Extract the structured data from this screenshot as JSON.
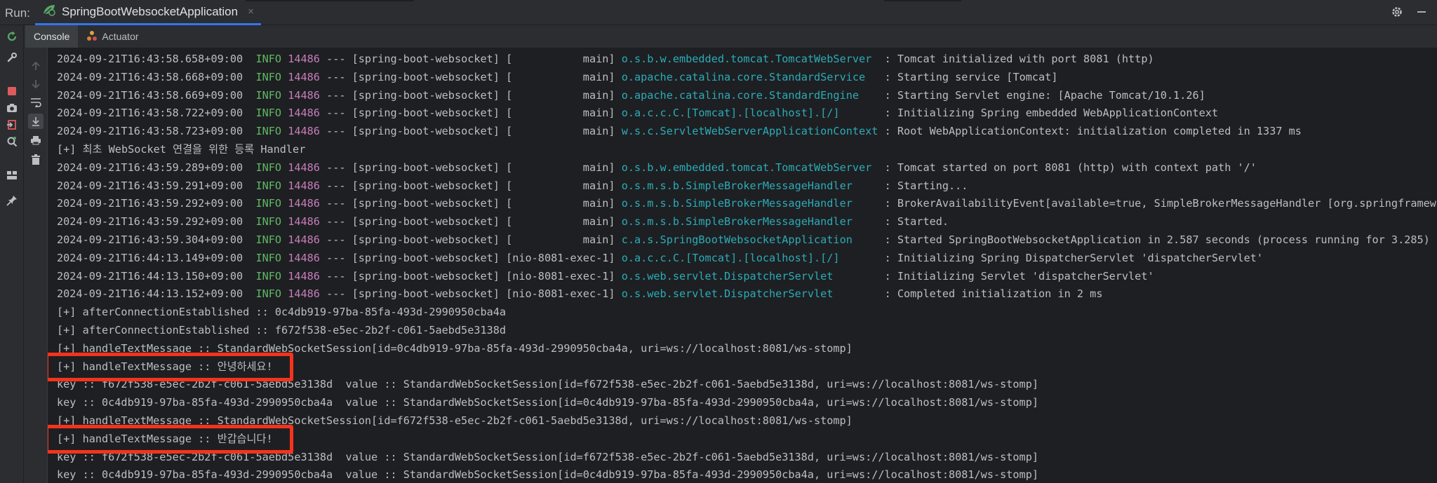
{
  "run": {
    "label": "Run:",
    "tab_title": "SpringBootWebsocketApplication",
    "close": "×"
  },
  "tabs": [
    {
      "label": "Console"
    },
    {
      "label": "Actuator"
    }
  ],
  "colors": {
    "info": "#5fb865",
    "pid": "#c77dbb",
    "logger": "#2aacb8",
    "highlight": "#f5331c",
    "run_green": "#59a869",
    "stop_red": "#db5c5c"
  },
  "log_lines": [
    {
      "ts": "2024-09-21T16:43:58.658+09:00",
      "level": "INFO",
      "pid": "14486",
      "mid": " --- [spring-boot-websocket] [           main] ",
      "logger": "o.s.b.w.embedded.tomcat.TomcatWebServer ",
      "msg": " : Tomcat initialized with port 8081 (http)"
    },
    {
      "ts": "2024-09-21T16:43:58.668+09:00",
      "level": "INFO",
      "pid": "14486",
      "mid": " --- [spring-boot-websocket] [           main] ",
      "logger": "o.apache.catalina.core.StandardService  ",
      "msg": " : Starting service [Tomcat]"
    },
    {
      "ts": "2024-09-21T16:43:58.669+09:00",
      "level": "INFO",
      "pid": "14486",
      "mid": " --- [spring-boot-websocket] [           main] ",
      "logger": "o.apache.catalina.core.StandardEngine   ",
      "msg": " : Starting Servlet engine: [Apache Tomcat/10.1.26]"
    },
    {
      "ts": "2024-09-21T16:43:58.722+09:00",
      "level": "INFO",
      "pid": "14486",
      "mid": " --- [spring-boot-websocket] [           main] ",
      "logger": "o.a.c.c.C.[Tomcat].[localhost].[/]      ",
      "msg": " : Initializing Spring embedded WebApplicationContext"
    },
    {
      "ts": "2024-09-21T16:43:58.723+09:00",
      "level": "INFO",
      "pid": "14486",
      "mid": " --- [spring-boot-websocket] [           main] ",
      "logger": "w.s.c.ServletWebServerApplicationContext",
      "msg": " : Root WebApplicationContext: initialization completed in 1337 ms"
    },
    {
      "plain": "[+] 최초 WebSocket 연결을 위한 등록 Handler"
    },
    {
      "ts": "2024-09-21T16:43:59.289+09:00",
      "level": "INFO",
      "pid": "14486",
      "mid": " --- [spring-boot-websocket] [           main] ",
      "logger": "o.s.b.w.embedded.tomcat.TomcatWebServer ",
      "msg": " : Tomcat started on port 8081 (http) with context path '/'"
    },
    {
      "ts": "2024-09-21T16:43:59.291+09:00",
      "level": "INFO",
      "pid": "14486",
      "mid": " --- [spring-boot-websocket] [           main] ",
      "logger": "o.s.m.s.b.SimpleBrokerMessageHandler    ",
      "msg": " : Starting..."
    },
    {
      "ts": "2024-09-21T16:43:59.292+09:00",
      "level": "INFO",
      "pid": "14486",
      "mid": " --- [spring-boot-websocket] [           main] ",
      "logger": "o.s.m.s.b.SimpleBrokerMessageHandler    ",
      "msg": " : BrokerAvailabilityEvent[available=true, SimpleBrokerMessageHandler [org.springframew"
    },
    {
      "ts": "2024-09-21T16:43:59.292+09:00",
      "level": "INFO",
      "pid": "14486",
      "mid": " --- [spring-boot-websocket] [           main] ",
      "logger": "o.s.m.s.b.SimpleBrokerMessageHandler    ",
      "msg": " : Started."
    },
    {
      "ts": "2024-09-21T16:43:59.304+09:00",
      "level": "INFO",
      "pid": "14486",
      "mid": " --- [spring-boot-websocket] [           main] ",
      "logger": "c.a.s.SpringBootWebsocketApplication    ",
      "msg": " : Started SpringBootWebsocketApplication in 2.587 seconds (process running for 3.285)"
    },
    {
      "ts": "2024-09-21T16:44:13.149+09:00",
      "level": "INFO",
      "pid": "14486",
      "mid": " --- [spring-boot-websocket] [nio-8081-exec-1] ",
      "logger": "o.a.c.c.C.[Tomcat].[localhost].[/]      ",
      "msg": " : Initializing Spring DispatcherServlet 'dispatcherServlet'"
    },
    {
      "ts": "2024-09-21T16:44:13.150+09:00",
      "level": "INFO",
      "pid": "14486",
      "mid": " --- [spring-boot-websocket] [nio-8081-exec-1] ",
      "logger": "o.s.web.servlet.DispatcherServlet       ",
      "msg": " : Initializing Servlet 'dispatcherServlet'"
    },
    {
      "ts": "2024-09-21T16:44:13.152+09:00",
      "level": "INFO",
      "pid": "14486",
      "mid": " --- [spring-boot-websocket] [nio-8081-exec-1] ",
      "logger": "o.s.web.servlet.DispatcherServlet       ",
      "msg": " : Completed initialization in 2 ms"
    },
    {
      "plain": "[+] afterConnectionEstablished :: 0c4db919-97ba-85fa-493d-2990950cba4a"
    },
    {
      "plain": "[+] afterConnectionEstablished :: f672f538-e5ec-2b2f-c061-5aebd5e3138d"
    },
    {
      "plain": "[+] handleTextMessage :: StandardWebSocketSession[id=0c4db919-97ba-85fa-493d-2990950cba4a, uri=ws://localhost:8081/ws-stomp]"
    },
    {
      "plain": "[+] handleTextMessage :: 안녕하세요!"
    },
    {
      "plain": "key :: f672f538-e5ec-2b2f-c061-5aebd5e3138d  value :: StandardWebSocketSession[id=f672f538-e5ec-2b2f-c061-5aebd5e3138d, uri=ws://localhost:8081/ws-stomp]"
    },
    {
      "plain": "key :: 0c4db919-97ba-85fa-493d-2990950cba4a  value :: StandardWebSocketSession[id=0c4db919-97ba-85fa-493d-2990950cba4a, uri=ws://localhost:8081/ws-stomp]"
    },
    {
      "plain": "[+] handleTextMessage :: StandardWebSocketSession[id=f672f538-e5ec-2b2f-c061-5aebd5e3138d, uri=ws://localhost:8081/ws-stomp]"
    },
    {
      "plain": "[+] handleTextMessage :: 반갑습니다!"
    },
    {
      "plain": "key :: f672f538-e5ec-2b2f-c061-5aebd5e3138d  value :: StandardWebSocketSession[id=f672f538-e5ec-2b2f-c061-5aebd5e3138d, uri=ws://localhost:8081/ws-stomp]"
    },
    {
      "plain": "key :: 0c4db919-97ba-85fa-493d-2990950cba4a  value :: StandardWebSocketSession[id=0c4db919-97ba-85fa-493d-2990950cba4a, uri=ws://localhost:8081/ws-stomp]"
    }
  ],
  "highlighted_lines": [
    17,
    21
  ]
}
